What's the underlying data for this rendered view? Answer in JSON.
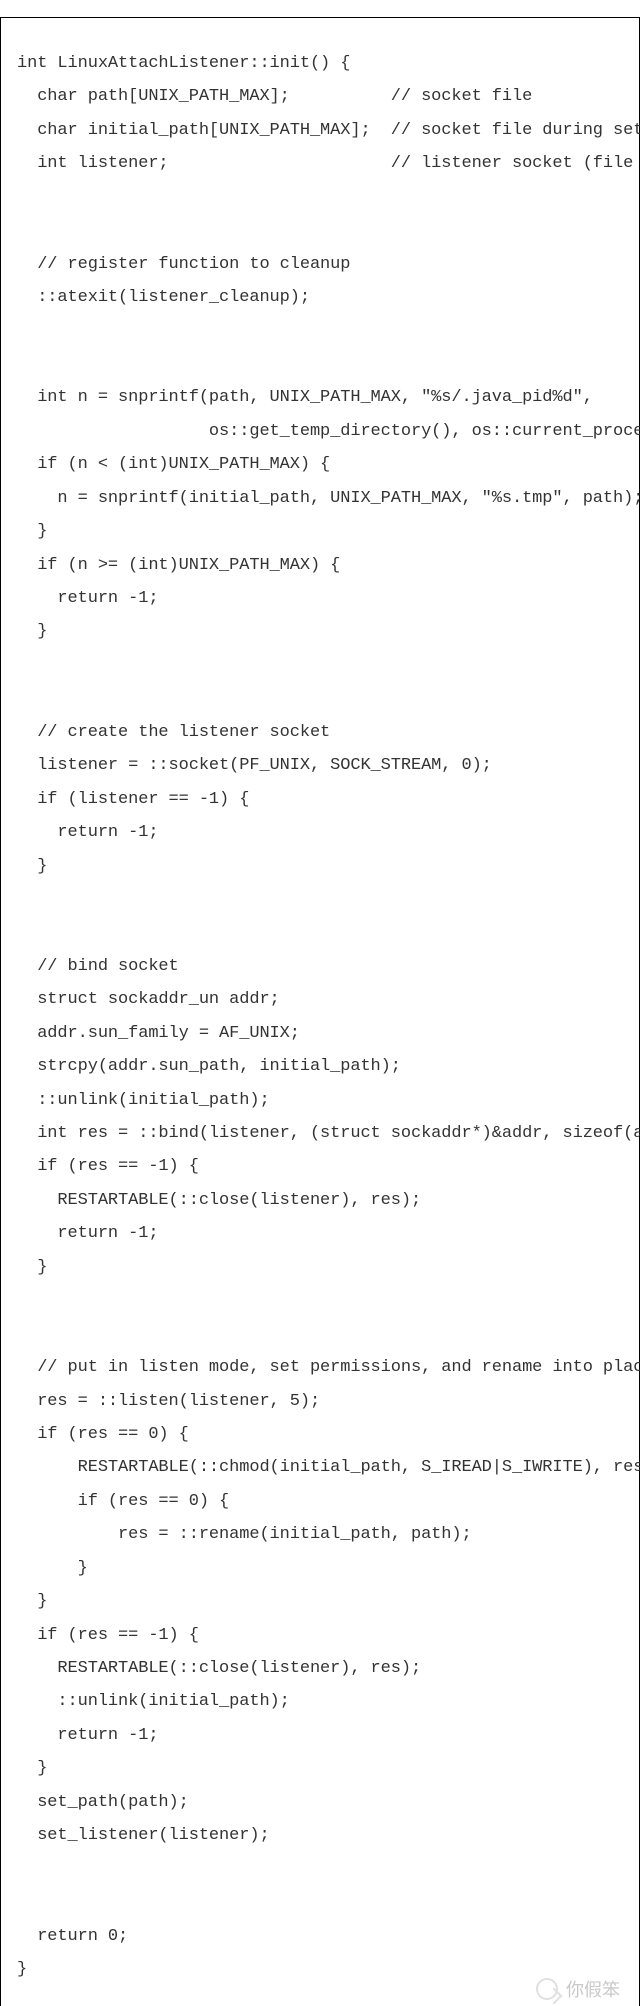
{
  "code": {
    "lines": [
      "int LinuxAttachListener::init() {",
      "  char path[UNIX_PATH_MAX];          // socket file",
      "  char initial_path[UNIX_PATH_MAX];  // socket file during setup",
      "  int listener;                      // listener socket (file descriptor)",
      "",
      "",
      "  // register function to cleanup",
      "  ::atexit(listener_cleanup);",
      "",
      "",
      "  int n = snprintf(path, UNIX_PATH_MAX, \"%s/.java_pid%d\",",
      "                   os::get_temp_directory(), os::current_process_id());",
      "  if (n < (int)UNIX_PATH_MAX) {",
      "    n = snprintf(initial_path, UNIX_PATH_MAX, \"%s.tmp\", path);",
      "  }",
      "  if (n >= (int)UNIX_PATH_MAX) {",
      "    return -1;",
      "  }",
      "",
      "",
      "  // create the listener socket",
      "  listener = ::socket(PF_UNIX, SOCK_STREAM, 0);",
      "  if (listener == -1) {",
      "    return -1;",
      "  }",
      "",
      "",
      "  // bind socket",
      "  struct sockaddr_un addr;",
      "  addr.sun_family = AF_UNIX;",
      "  strcpy(addr.sun_path, initial_path);",
      "  ::unlink(initial_path);",
      "  int res = ::bind(listener, (struct sockaddr*)&addr, sizeof(addr));",
      "  if (res == -1) {",
      "    RESTARTABLE(::close(listener), res);",
      "    return -1;",
      "  }",
      "",
      "",
      "  // put in listen mode, set permissions, and rename into place",
      "  res = ::listen(listener, 5);",
      "  if (res == 0) {",
      "      RESTARTABLE(::chmod(initial_path, S_IREAD|S_IWRITE), res);",
      "      if (res == 0) {",
      "          res = ::rename(initial_path, path);",
      "      }",
      "  }",
      "  if (res == -1) {",
      "    RESTARTABLE(::close(listener), res);",
      "    ::unlink(initial_path);",
      "    return -1;",
      "  }",
      "  set_path(path);",
      "  set_listener(listener);",
      "",
      "",
      "  return 0;",
      "}"
    ]
  },
  "watermark": {
    "text": "你假笨"
  }
}
